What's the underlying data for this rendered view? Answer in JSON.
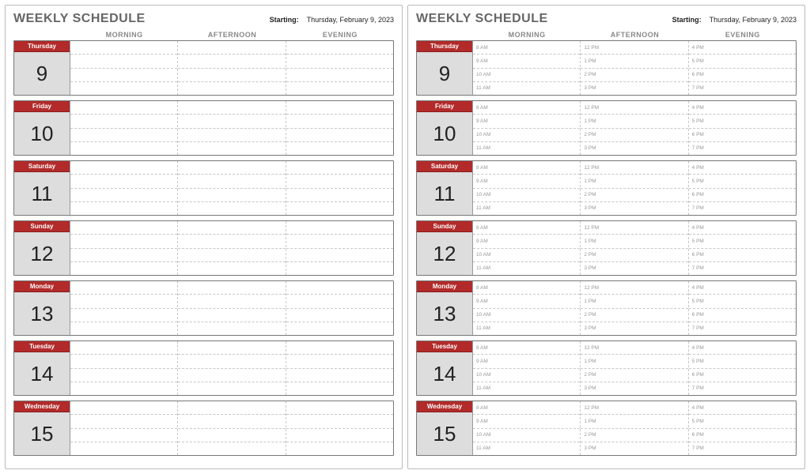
{
  "title": "WEEKLY SCHEDULE",
  "starting_label": "Starting:",
  "starting_date": "Thursday, February 9, 2023",
  "column_headers": [
    "MORNING",
    "AFTERNOON",
    "EVENING"
  ],
  "time_slots": {
    "morning": [
      "8 AM",
      "9 AM",
      "10 AM",
      "11 AM"
    ],
    "afternoon": [
      "12 PM",
      "1 PM",
      "2 PM",
      "3 PM"
    ],
    "evening": [
      "4 PM",
      "5 PM",
      "6 PM",
      "7 PM"
    ]
  },
  "days": [
    {
      "name": "Thursday",
      "num": "9"
    },
    {
      "name": "Friday",
      "num": "10"
    },
    {
      "name": "Saturday",
      "num": "11"
    },
    {
      "name": "Sunday",
      "num": "12"
    },
    {
      "name": "Monday",
      "num": "13"
    },
    {
      "name": "Tuesday",
      "num": "14"
    },
    {
      "name": "Wednesday",
      "num": "15"
    }
  ],
  "pages": [
    {
      "show_times": false
    },
    {
      "show_times": true
    }
  ]
}
